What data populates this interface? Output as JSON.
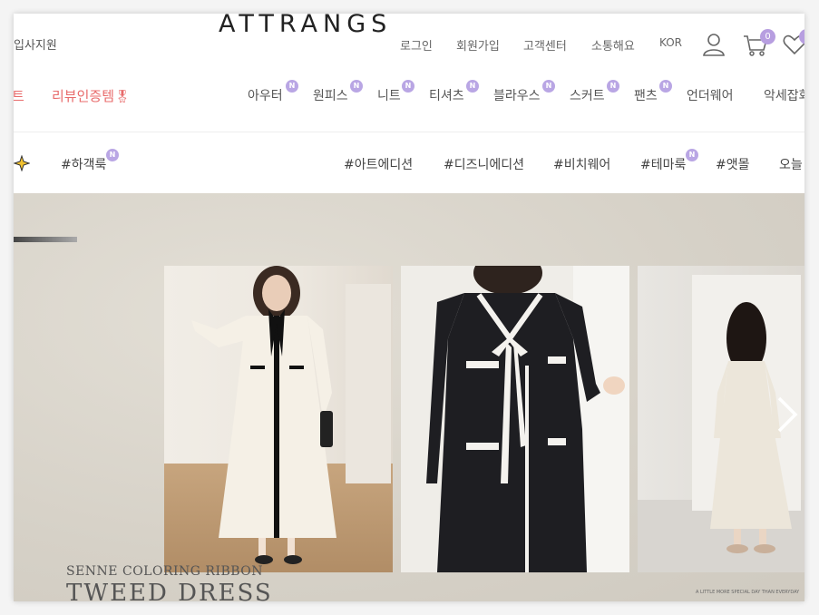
{
  "header": {
    "logo": "ATTRANGS",
    "recruit_link": "입사지원",
    "links": [
      "로그인",
      "회원가입",
      "고객센터",
      "소통해요",
      "KOR"
    ],
    "cart_count": "0"
  },
  "nav": {
    "left_items": [
      "트",
      "리뷰인증템"
    ],
    "items": [
      {
        "label": "아우터",
        "new": "N"
      },
      {
        "label": "원피스",
        "new": "N"
      },
      {
        "label": "니트",
        "new": "N"
      },
      {
        "label": "티셔츠",
        "new": "N"
      },
      {
        "label": "블라우스",
        "new": "N"
      },
      {
        "label": "스커트",
        "new": "N"
      },
      {
        "label": "팬츠",
        "new": "N"
      },
      {
        "label": "언더웨어"
      },
      {
        "label": "악세잡화"
      }
    ]
  },
  "tags": [
    {
      "label": "#하객룩",
      "new": "N"
    },
    {
      "label": "#아트에디션"
    },
    {
      "label": "#디즈니에디션"
    },
    {
      "label": "#비치웨어"
    },
    {
      "label": "#테마룩",
      "new": "N"
    },
    {
      "label": "#앳몰"
    },
    {
      "label": "오늘"
    }
  ],
  "banner": {
    "subtitle": "SENNE COLORING RIBBON",
    "title": "TWEED DRESS",
    "fineprint": "A LITTLE MORE SPECIAL DAY THAN EVERYDAY"
  },
  "colors": {
    "accent": "#b9a6e4",
    "sale": "#e86b6b"
  }
}
